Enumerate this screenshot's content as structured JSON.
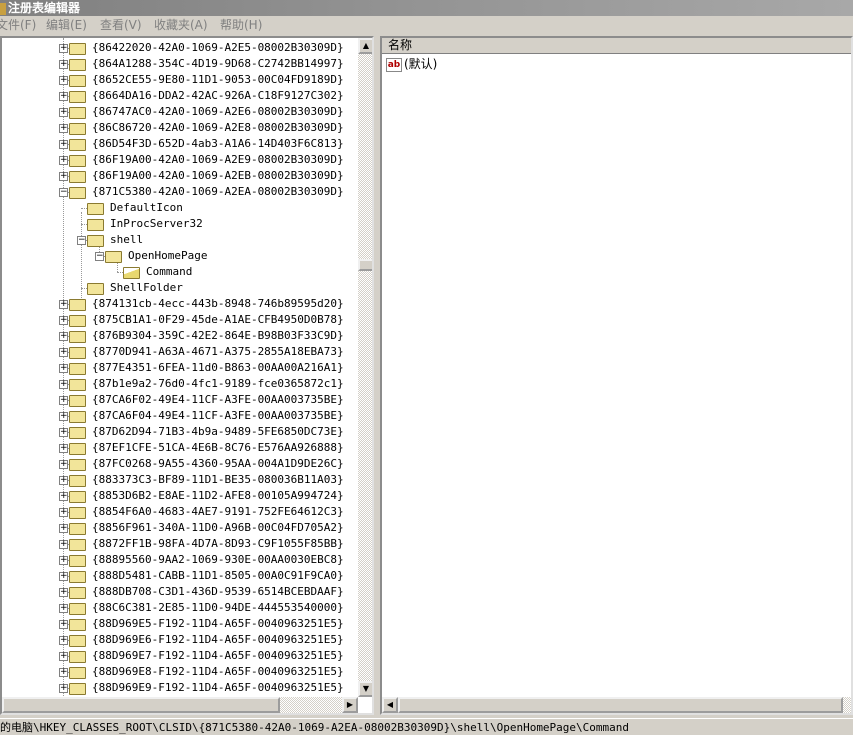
{
  "title": "注册表编辑器",
  "menu": [
    "文件(F)",
    "编辑(E)",
    "查看(V)",
    "收藏夹(A)",
    "帮助(H)"
  ],
  "tree": [
    {
      "level": 0,
      "exp": "+",
      "label": "{86422020-42A0-1069-A2E5-08002B30309D}"
    },
    {
      "level": 0,
      "exp": "+",
      "label": "{864A1288-354C-4D19-9D68-C2742BB14997}"
    },
    {
      "level": 0,
      "exp": "+",
      "label": "{8652CE55-9E80-11D1-9053-00C04FD9189D}"
    },
    {
      "level": 0,
      "exp": "+",
      "label": "{8664DA16-DDA2-42AC-926A-C18F9127C302}"
    },
    {
      "level": 0,
      "exp": "+",
      "label": "{86747AC0-42A0-1069-A2E6-08002B30309D}"
    },
    {
      "level": 0,
      "exp": "+",
      "label": "{86C86720-42A0-1069-A2E8-08002B30309D}"
    },
    {
      "level": 0,
      "exp": "+",
      "label": "{86D54F3D-652D-4ab3-A1A6-14D403F6C813}"
    },
    {
      "level": 0,
      "exp": "+",
      "label": "{86F19A00-42A0-1069-A2E9-08002B30309D}"
    },
    {
      "level": 0,
      "exp": "+",
      "label": "{86F19A00-42A0-1069-A2EB-08002B30309D}"
    },
    {
      "level": 0,
      "exp": "-",
      "label": "{871C5380-42A0-1069-A2EA-08002B30309D}"
    },
    {
      "level": 1,
      "exp": "",
      "label": "DefaultIcon"
    },
    {
      "level": 1,
      "exp": "",
      "label": "InProcServer32"
    },
    {
      "level": 1,
      "exp": "-",
      "label": "shell"
    },
    {
      "level": 2,
      "exp": "-",
      "label": "OpenHomePage"
    },
    {
      "level": 3,
      "exp": "",
      "label": "Command",
      "open": true
    },
    {
      "level": 1,
      "exp": "",
      "label": "ShellFolder"
    },
    {
      "level": 0,
      "exp": "+",
      "label": "{874131cb-4ecc-443b-8948-746b89595d20}"
    },
    {
      "level": 0,
      "exp": "+",
      "label": "{875CB1A1-0F29-45de-A1AE-CFB4950D0B78}"
    },
    {
      "level": 0,
      "exp": "+",
      "label": "{876B9304-359C-42E2-864E-B98B03F33C9D}"
    },
    {
      "level": 0,
      "exp": "+",
      "label": "{8770D941-A63A-4671-A375-2855A18EBA73}"
    },
    {
      "level": 0,
      "exp": "+",
      "label": "{877E4351-6FEA-11d0-B863-00AA00A216A1}"
    },
    {
      "level": 0,
      "exp": "+",
      "label": "{87b1e9a2-76d0-4fc1-9189-fce0365872c1}"
    },
    {
      "level": 0,
      "exp": "+",
      "label": "{87CA6F02-49E4-11CF-A3FE-00AA003735BE}"
    },
    {
      "level": 0,
      "exp": "+",
      "label": "{87CA6F04-49E4-11CF-A3FE-00AA003735BE}"
    },
    {
      "level": 0,
      "exp": "+",
      "label": "{87D62D94-71B3-4b9a-9489-5FE6850DC73E}"
    },
    {
      "level": 0,
      "exp": "+",
      "label": "{87EF1CFE-51CA-4E6B-8C76-E576AA926888}"
    },
    {
      "level": 0,
      "exp": "+",
      "label": "{87FC0268-9A55-4360-95AA-004A1D9DE26C}"
    },
    {
      "level": 0,
      "exp": "+",
      "label": "{883373C3-BF89-11D1-BE35-080036B11A03}"
    },
    {
      "level": 0,
      "exp": "+",
      "label": "{8853D6B2-E8AE-11D2-AFE8-00105A994724}"
    },
    {
      "level": 0,
      "exp": "+",
      "label": "{8854F6A0-4683-4AE7-9191-752FE64612C3}"
    },
    {
      "level": 0,
      "exp": "+",
      "label": "{8856F961-340A-11D0-A96B-00C04FD705A2}"
    },
    {
      "level": 0,
      "exp": "+",
      "label": "{8872FF1B-98FA-4D7A-8D93-C9F1055F85BB}"
    },
    {
      "level": 0,
      "exp": "+",
      "label": "{88895560-9AA2-1069-930E-00AA0030EBC8}"
    },
    {
      "level": 0,
      "exp": "+",
      "label": "{888D5481-CABB-11D1-8505-00A0C91F9CA0}"
    },
    {
      "level": 0,
      "exp": "+",
      "label": "{888DB708-C3D1-436D-9539-6514BCEBDAAF}"
    },
    {
      "level": 0,
      "exp": "+",
      "label": "{88C6C381-2E85-11D0-94DE-444553540000}"
    },
    {
      "level": 0,
      "exp": "+",
      "label": "{88D969E5-F192-11D4-A65F-0040963251E5}"
    },
    {
      "level": 0,
      "exp": "+",
      "label": "{88D969E6-F192-11D4-A65F-0040963251E5}"
    },
    {
      "level": 0,
      "exp": "+",
      "label": "{88D969E7-F192-11D4-A65F-0040963251E5}"
    },
    {
      "level": 0,
      "exp": "+",
      "label": "{88D969E8-F192-11D4-A65F-0040963251E5}"
    },
    {
      "level": 0,
      "exp": "+",
      "label": "{88D969E9-F192-11D4-A65F-0040963251E5}"
    }
  ],
  "list": {
    "column_name": "名称",
    "values": [
      {
        "icon": "ab",
        "name": "(默认)"
      }
    ]
  },
  "status": "的电脑\\HKEY_CLASSES_ROOT\\CLSID\\{871C5380-42A0-1069-A2EA-08002B30309D}\\shell\\OpenHomePage\\Command"
}
